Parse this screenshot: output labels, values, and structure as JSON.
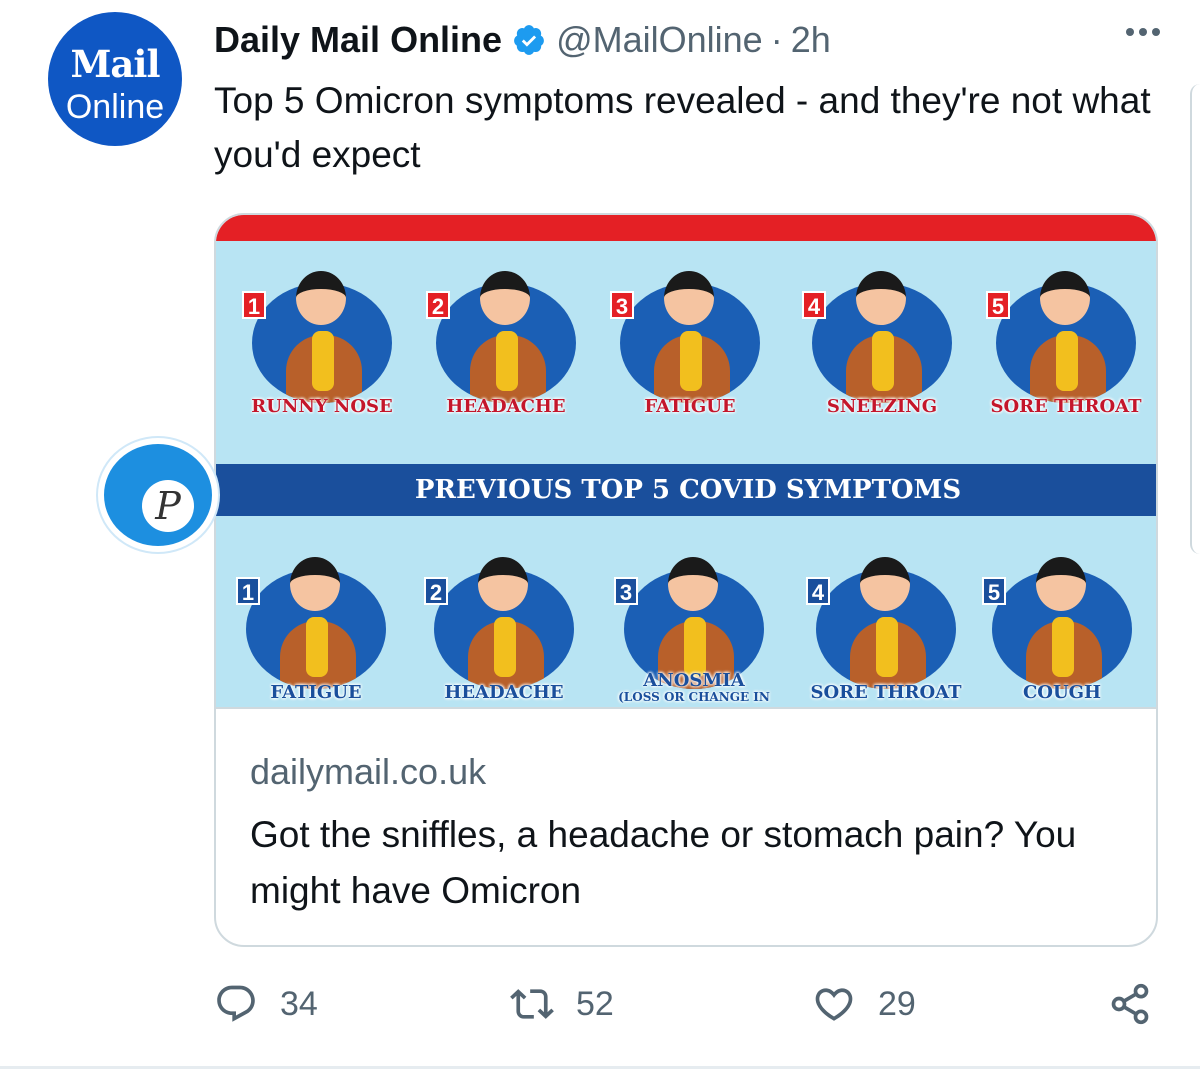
{
  "avatar": {
    "line1": "Mail",
    "line2": "Online",
    "color": "#0f57c4"
  },
  "header": {
    "display_name": "Daily Mail Online",
    "verified_icon": "verified-badge-icon",
    "handle": "@MailOnline",
    "separator": "·",
    "time": "2h",
    "more_icon": "more-options-icon"
  },
  "tweet": {
    "text": "Top 5 Omicron symptoms revealed - and they're not what you'd expect"
  },
  "card": {
    "image": {
      "banner": "PREVIOUS TOP 5 COVID SYMPTOMS",
      "omicron": [
        {
          "num": "1",
          "label": "RUNNY NOSE"
        },
        {
          "num": "2",
          "label": "HEADACHE"
        },
        {
          "num": "3",
          "label": "FATIGUE"
        },
        {
          "num": "4",
          "label": "SNEEZING"
        },
        {
          "num": "5",
          "label": "SORE THROAT"
        }
      ],
      "previous": [
        {
          "num": "1",
          "label": "FATIGUE"
        },
        {
          "num": "2",
          "label": "HEADACHE"
        },
        {
          "num": "3",
          "label": "ANOSMIA",
          "sub": "(LOSS OR CHANGE IN"
        },
        {
          "num": "4",
          "label": "SORE THROAT"
        },
        {
          "num": "5",
          "label": "COUGH"
        }
      ],
      "colors": {
        "red": "#e42025",
        "blue": "#1a4f9c",
        "background": "#b8e4f3"
      }
    },
    "domain": "dailymail.co.uk",
    "title": "Got the sniffles, a headache or stomach pain? You might have Omicron"
  },
  "watermark": {
    "letter": "P",
    "icon": "twitter-bird-icon"
  },
  "actions": {
    "reply": {
      "icon": "reply-icon",
      "count": "34"
    },
    "retweet": {
      "icon": "retweet-icon",
      "count": "52"
    },
    "like": {
      "icon": "heart-icon",
      "count": "29"
    },
    "share": {
      "icon": "share-icon"
    }
  },
  "accent": "#1d9bf0"
}
